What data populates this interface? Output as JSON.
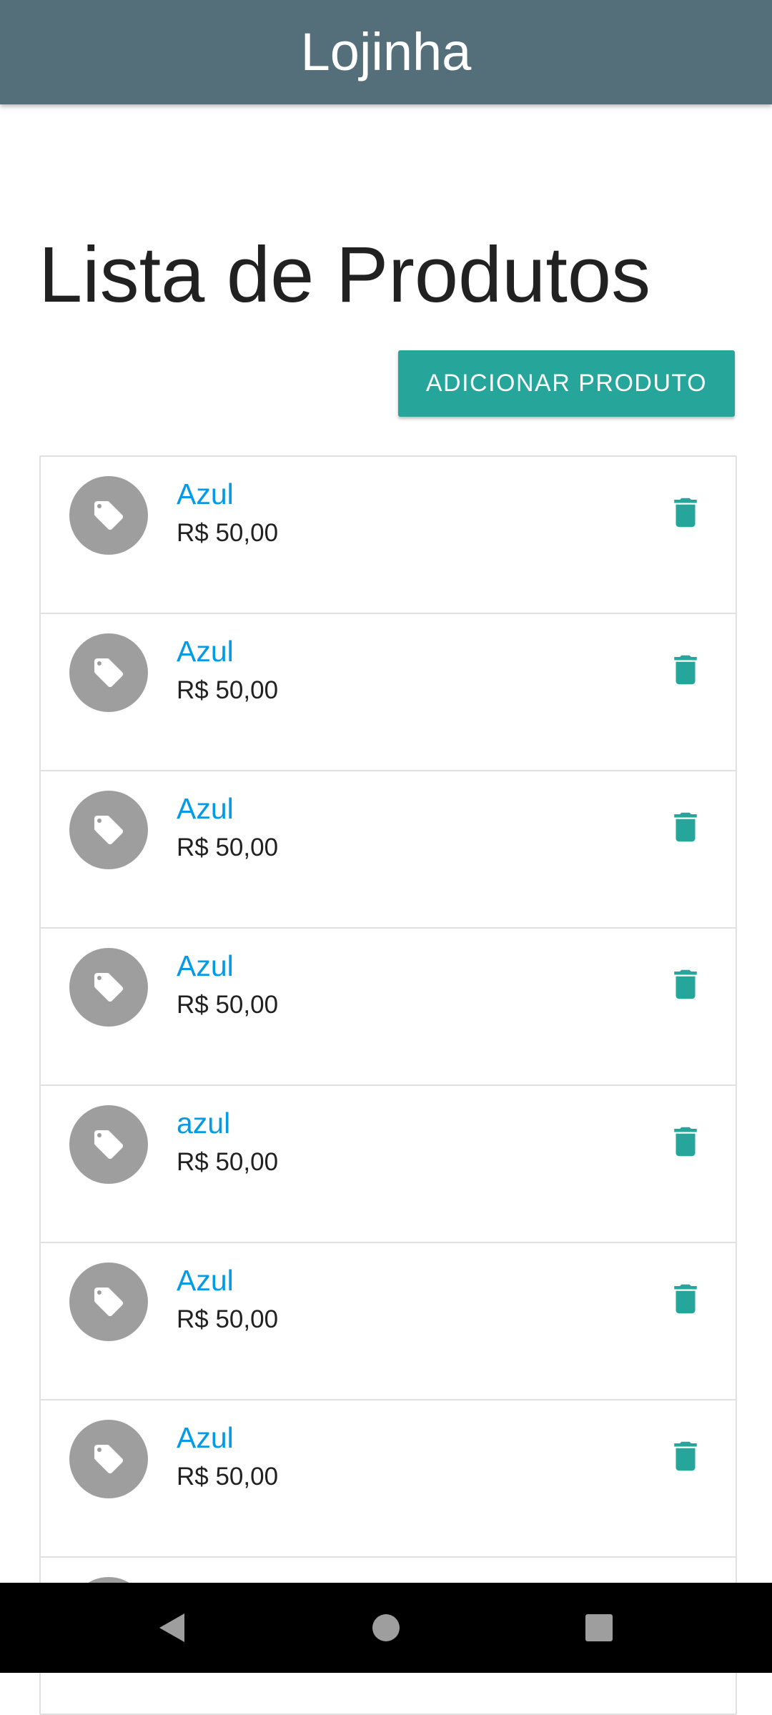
{
  "app_bar": {
    "title": "Lojinha"
  },
  "main": {
    "page_title": "Lista de Produtos",
    "add_button_label": "ADICIONAR PRODUTO"
  },
  "products": [
    {
      "name": "Azul",
      "price": "R$ 50,00"
    },
    {
      "name": "Azul",
      "price": "R$ 50,00"
    },
    {
      "name": "Azul",
      "price": "R$ 50,00"
    },
    {
      "name": "Azul",
      "price": "R$ 50,00"
    },
    {
      "name": "azul",
      "price": "R$ 50,00"
    },
    {
      "name": "Azul",
      "price": "R$ 50,00"
    },
    {
      "name": "Azul",
      "price": "R$ 50,00"
    },
    {
      "name": "",
      "price": ""
    }
  ],
  "icons": {
    "avatar": "tag-icon",
    "item_action": "trash-icon",
    "nav_back": "back-triangle-icon",
    "nav_home": "home-circle-icon",
    "nav_recents": "recents-square-icon"
  },
  "colors": {
    "app_bar": "#546e7a",
    "accent": "#26a69a",
    "link": "#039be5",
    "avatar_bg": "#9e9e9e",
    "nav_bar": "#000000"
  }
}
